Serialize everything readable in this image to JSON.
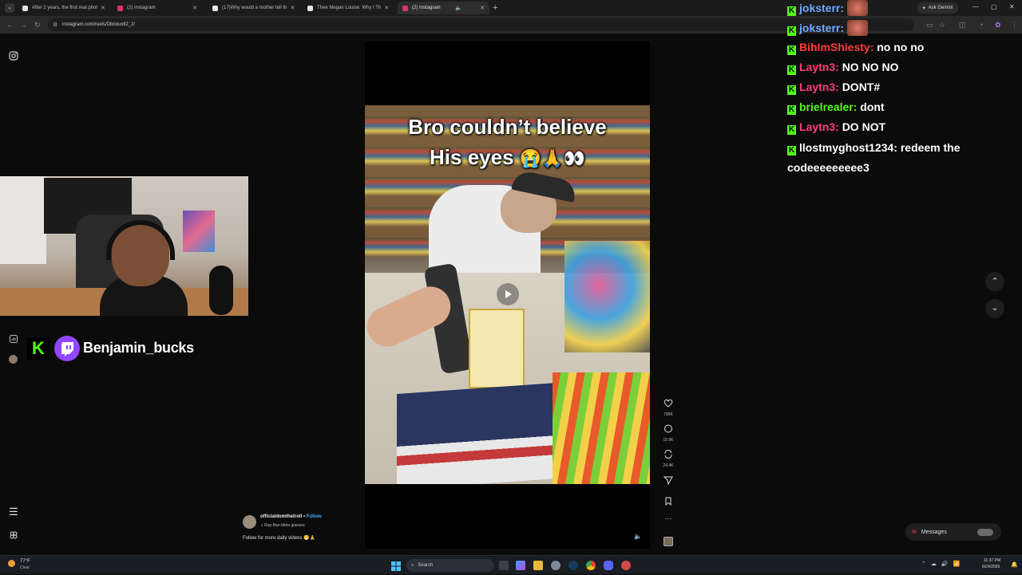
{
  "browser": {
    "tabs": [
      {
        "label": "After 2 years, the first real phot",
        "fav": "#e5e5e5"
      },
      {
        "label": "(2) Instagram",
        "fav": "#e1306c"
      },
      {
        "label": "(17)Why would a mother tell th",
        "fav": "#e5e5e5"
      },
      {
        "label": "Thee Megan Louise: Why I Th",
        "fav": "#e5e5e5"
      },
      {
        "label": "(2) Instagram",
        "fav": "#e1306c"
      }
    ],
    "url": "instagram.com/reels/Dboouxtl2_2/",
    "ask_gemini": "Ask Gemini"
  },
  "streamer": {
    "name": "Benjamin_bucks"
  },
  "reel": {
    "caption_line1": "Bro couldn’t believe",
    "caption_line2": "His eyes",
    "caption_emoji": "😭🙏👀",
    "author": "officialdomthetroll",
    "follow_label": "Follow",
    "audio": "Ray-Ban Meta glasses",
    "description": "Follow for more daily videos",
    "description_emoji": "😁🙏",
    "likes": "795K",
    "comments": "10.9K",
    "reposts": "24.4K"
  },
  "chat": [
    {
      "user": "joksterr:",
      "msg": "",
      "color": "#6fa8ff"
    },
    {
      "user": "joksterr:",
      "msg": "",
      "color": "#6fa8ff"
    },
    {
      "user": "BihImShiesty:",
      "msg": "no no no",
      "color": "#ff3b3b"
    },
    {
      "user": "Laytn3:",
      "msg": "NO NO NO",
      "color": "#ff3e7a"
    },
    {
      "user": "Laytn3:",
      "msg": "DONT#",
      "color": "#ff3e7a"
    },
    {
      "user": "brielrealer:",
      "msg": "dont",
      "color": "#53fc18"
    },
    {
      "user": "Laytn3:",
      "msg": "DO NOT",
      "color": "#ff3e7a"
    },
    {
      "user": "llostmyghost1234:",
      "msg": "redeem the",
      "color": "#ffffff"
    },
    {
      "user": "",
      "msg": "codeeeeeeeee3",
      "color": "#ffffff"
    }
  ],
  "messages_label": "Messages",
  "taskbar": {
    "weather_temp": "77°F",
    "weather_text": "Clear",
    "search_placeholder": "Search",
    "time": "11:37 PM",
    "date": "6/24/2026"
  },
  "colors": {
    "kick_green": "#53fc18",
    "twitch_purple": "#9146ff",
    "instagram_pink": "#e1306c"
  }
}
